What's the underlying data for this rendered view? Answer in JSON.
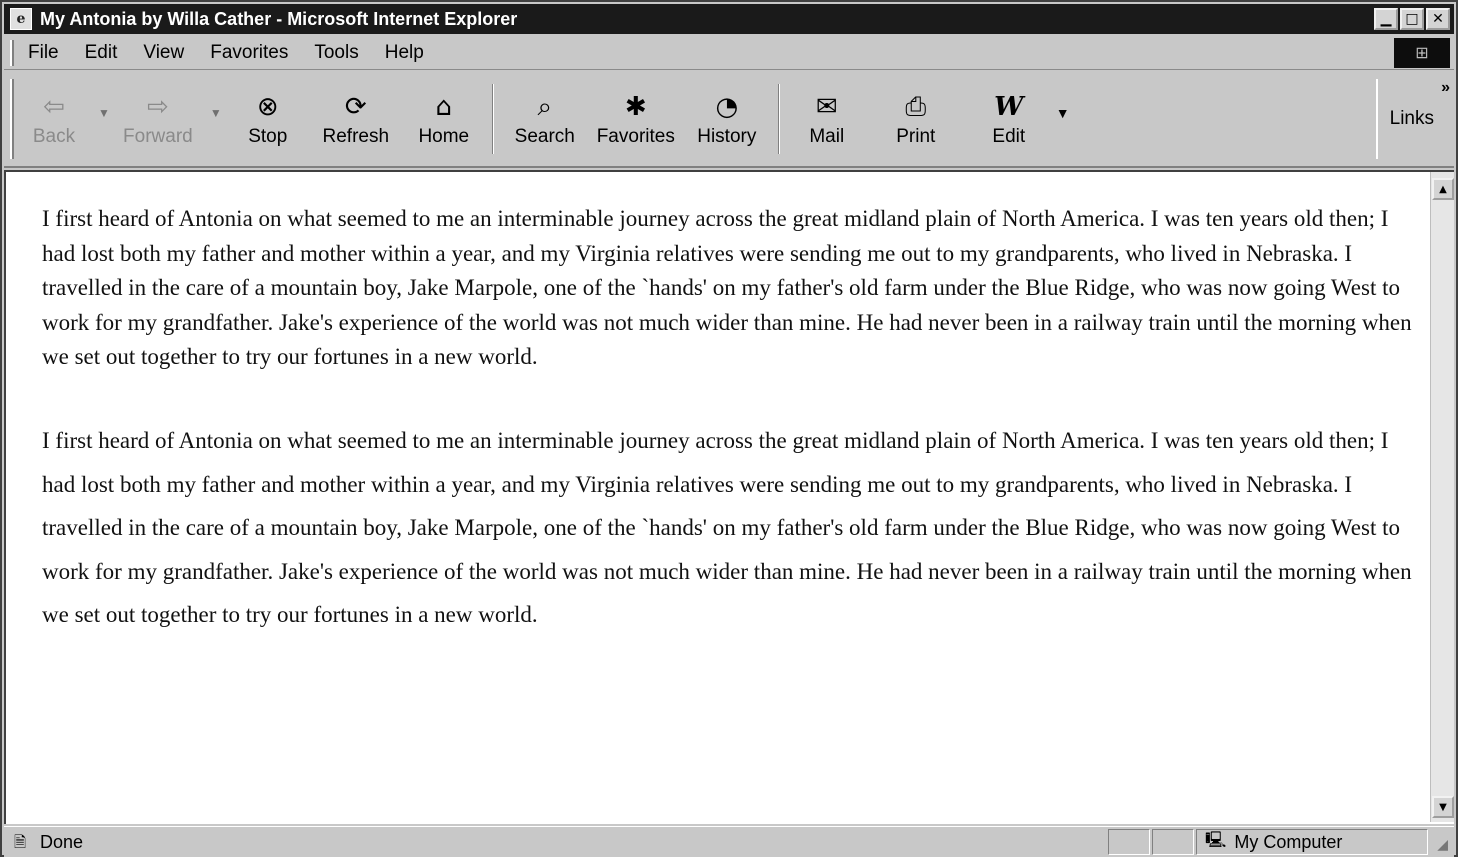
{
  "window": {
    "title": "My Antonia by Willa Cather - Microsoft Internet Explorer",
    "controls": {
      "minimize": "▁",
      "maximize": "□",
      "close": "✕"
    }
  },
  "menu": [
    {
      "label": "File"
    },
    {
      "label": "Edit"
    },
    {
      "label": "View"
    },
    {
      "label": "Favorites"
    },
    {
      "label": "Tools"
    },
    {
      "label": "Help"
    }
  ],
  "toolbar": {
    "back": {
      "label": "Back",
      "icon": "⇦"
    },
    "forward": {
      "label": "Forward",
      "icon": "⇨"
    },
    "stop": {
      "label": "Stop",
      "icon": "⊗"
    },
    "refresh": {
      "label": "Refresh",
      "icon": "⟳"
    },
    "home": {
      "label": "Home",
      "icon": "⌂"
    },
    "search": {
      "label": "Search",
      "icon": "⌕"
    },
    "favorites": {
      "label": "Favorites",
      "icon": "✱"
    },
    "history": {
      "label": "History",
      "icon": "◔"
    },
    "mail": {
      "label": "Mail",
      "icon": "✉"
    },
    "print": {
      "label": "Print",
      "icon": "⎙"
    },
    "edit": {
      "label": "Edit",
      "icon": "W"
    },
    "links": {
      "label": "Links",
      "chevron": "»"
    }
  },
  "document": {
    "paragraph1": "I first heard of Antonia on what seemed to me an interminable journey across the great midland plain of North America. I was ten years old then; I had lost both my father and mother within a year, and my Virginia relatives were sending me out to my grandparents, who lived in Nebraska. I travelled in the care of a mountain boy, Jake Marpole, one of the `hands' on my father's old farm under the Blue Ridge, who was now going West to work for my grandfather. Jake's experience of the world was not much wider than mine. He had never been in a railway train until the morning when we set out together to try our fortunes in a new world.",
    "paragraph2": "I first heard of Antonia on what seemed to me an interminable journey across the great midland plain of North America. I was ten years old then; I had lost both my father and mother within a year, and my Virginia relatives were sending me out to my grandparents, who lived in Nebraska. I travelled in the care of a mountain boy, Jake Marpole, one of the `hands' on my father's old farm under the Blue Ridge, who was now going West to work for my grandfather. Jake's experience of the world was not much wider than mine. He had never been in a railway train until the morning when we set out together to try our fortunes in a new world."
  },
  "statusbar": {
    "status": "Done",
    "zone": "My Computer"
  }
}
